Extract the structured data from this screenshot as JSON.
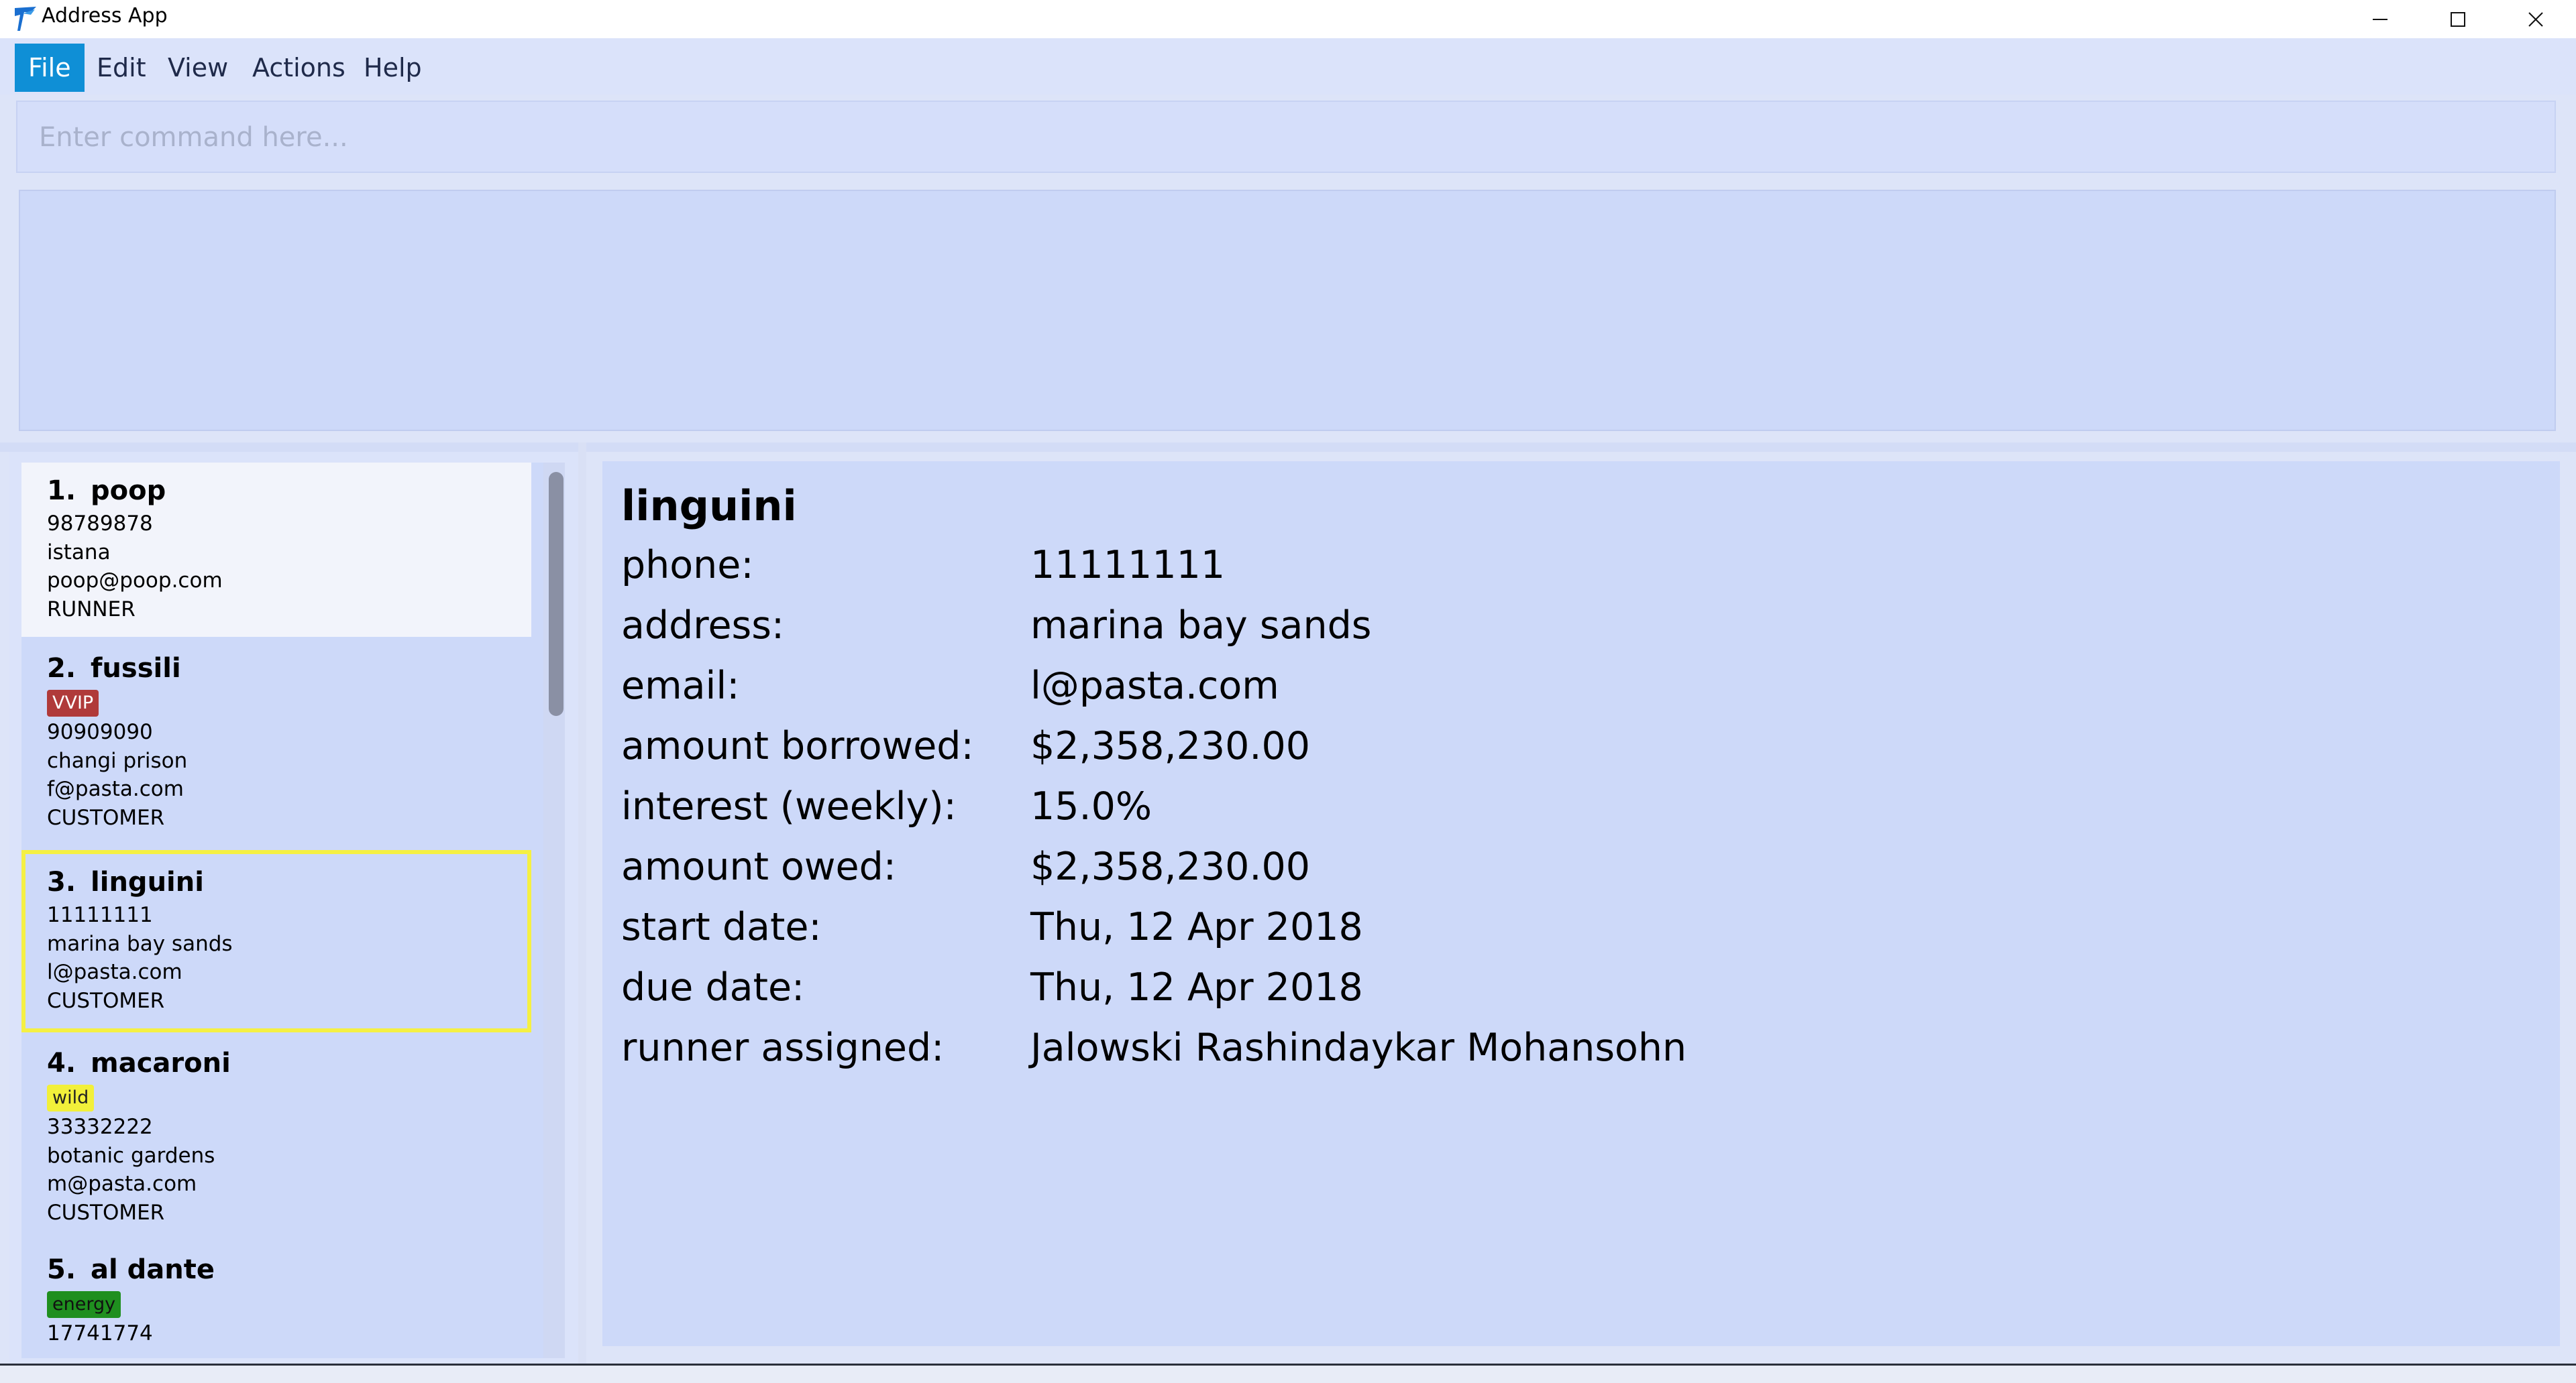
{
  "window": {
    "title": "Address App"
  },
  "menu": {
    "items": [
      {
        "label": "File",
        "active": true
      },
      {
        "label": "Edit"
      },
      {
        "label": "View"
      },
      {
        "label": "Actions"
      },
      {
        "label": "Help"
      }
    ]
  },
  "command": {
    "placeholder": "Enter command here...",
    "value": ""
  },
  "result": {
    "text": ""
  },
  "persons": [
    {
      "index": "1.",
      "name": "poop",
      "tag": "",
      "phone": "98789878",
      "address": "istana",
      "email": "poop@poop.com",
      "role": "RUNNER"
    },
    {
      "index": "2.",
      "name": "fussili",
      "tag": "VVIP",
      "tag_color": "#b03a3a",
      "phone": "90909090",
      "address": "changi prison",
      "email": "f@pasta.com",
      "role": "CUSTOMER"
    },
    {
      "index": "3.",
      "name": "linguini",
      "tag": "",
      "phone": "11111111",
      "address": "marina bay sands",
      "email": "l@pasta.com",
      "role": "CUSTOMER"
    },
    {
      "index": "4.",
      "name": "macaroni",
      "tag": "wild",
      "tag_color": "#f2f03a",
      "phone": "33332222",
      "address": "botanic gardens",
      "email": "m@pasta.com",
      "role": "CUSTOMER"
    },
    {
      "index": "5.",
      "name": "al dante",
      "tag": "energy",
      "tag_color": "#1f8f1f",
      "phone": "17741774",
      "address": "",
      "email": "",
      "role": ""
    }
  ],
  "selected_index": 2,
  "detail": {
    "name": "linguini",
    "rows": [
      {
        "label": "phone:",
        "value": "11111111"
      },
      {
        "label": "address:",
        "value": "marina bay sands"
      },
      {
        "label": "email:",
        "value": "l@pasta.com"
      },
      {
        "label": "amount borrowed:",
        "value": "$2,358,230.00"
      },
      {
        "label": "interest (weekly):",
        "value": "15.0%"
      },
      {
        "label": "amount owed:",
        "value": "$2,358,230.00"
      },
      {
        "label": "start date:",
        "value": "Thu, 12 Apr 2018"
      },
      {
        "label": "due date:",
        "value": "Thu, 12 Apr 2018"
      },
      {
        "label": "runner assigned:",
        "value": "Jalowski Rashindaykar Mohansohn"
      }
    ]
  },
  "colors": {
    "accent": "#0f8fd6",
    "selection_border": "#f5f043",
    "panel": "#cdd9f9"
  }
}
